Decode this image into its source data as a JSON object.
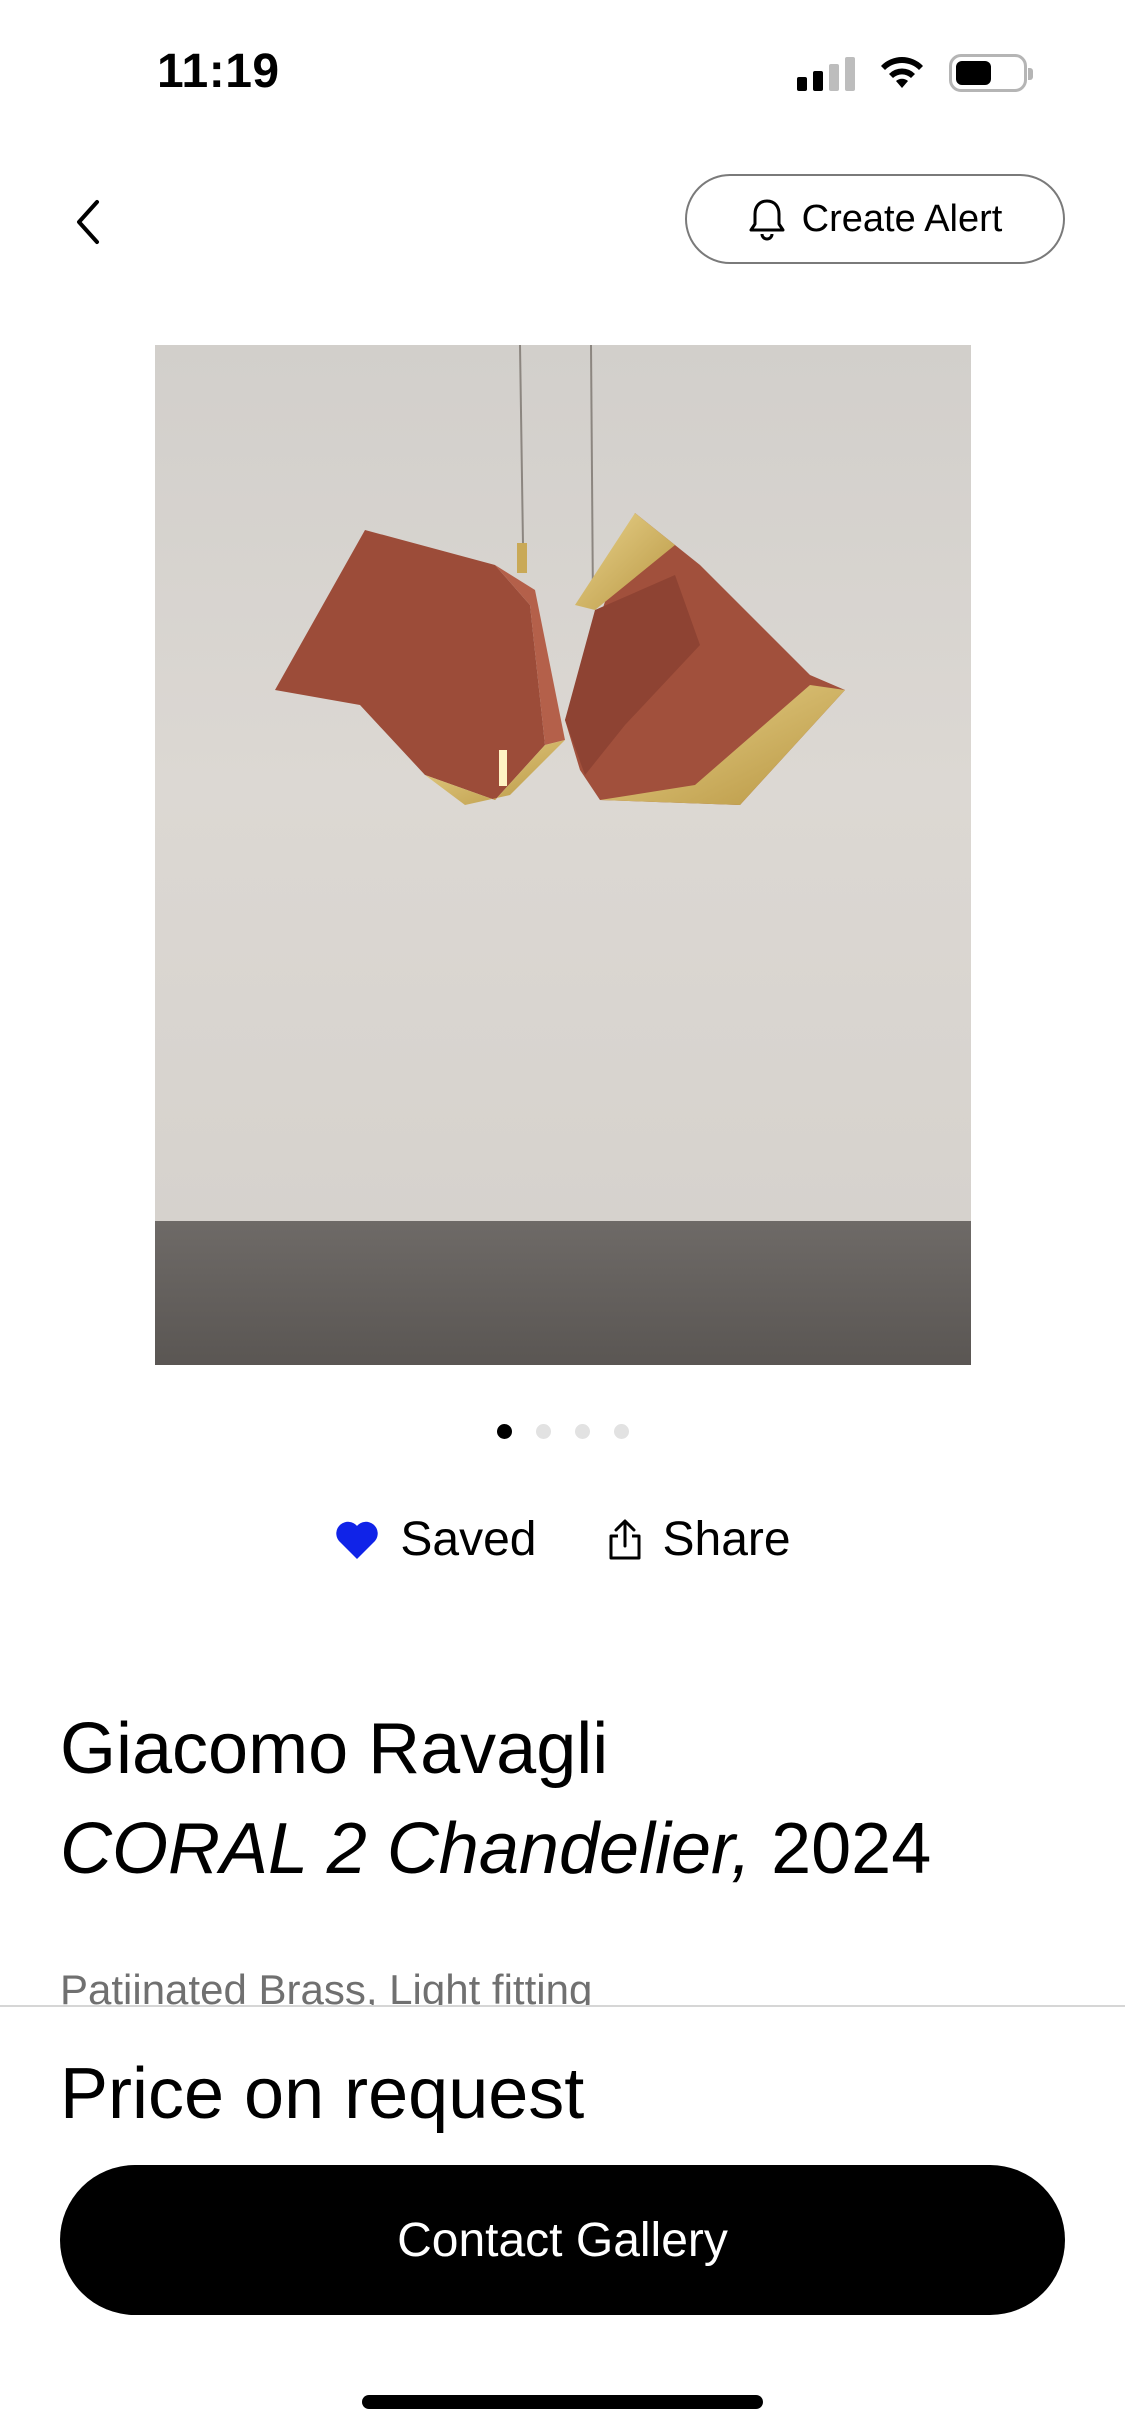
{
  "status_bar": {
    "time": "11:19",
    "battery_level_percent": 55
  },
  "nav": {
    "back_icon": "chevron-left-icon",
    "alert_icon": "bell-icon",
    "alert_label": "Create Alert"
  },
  "gallery": {
    "image_count": 4,
    "active_index": 0
  },
  "actions": {
    "saved_label": "Saved",
    "saved_icon": "heart-icon",
    "saved_color": "#1023E8",
    "share_label": "Share",
    "share_icon": "share-icon"
  },
  "artwork": {
    "artist": "Giacomo Ravagli",
    "title": "CORAL 2 Chandelier,",
    "year": "2024",
    "medium": "Patiinated Brass, Light fitting"
  },
  "purchase": {
    "price": "Price on request",
    "contact_label": "Contact Gallery"
  }
}
